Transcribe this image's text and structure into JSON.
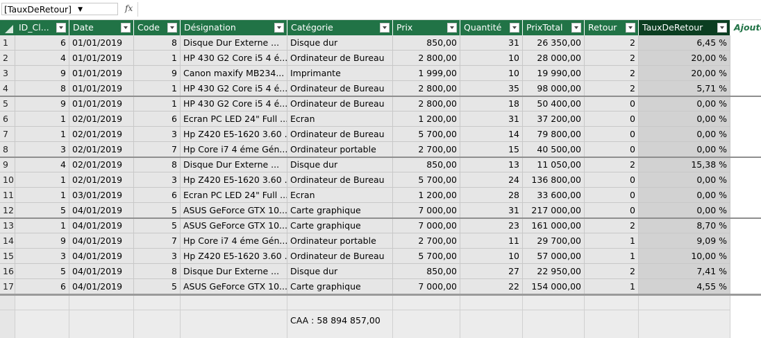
{
  "formula_bar": {
    "name_box": "[TauxDeRetour]",
    "fx_label": "fx",
    "formula": ""
  },
  "columns": [
    {
      "key": "id",
      "label": "ID_Cl..."
    },
    {
      "key": "date",
      "label": "Date"
    },
    {
      "key": "code",
      "label": "Code"
    },
    {
      "key": "designation",
      "label": "Désignation"
    },
    {
      "key": "categorie",
      "label": "Catégorie"
    },
    {
      "key": "prix",
      "label": "Prix"
    },
    {
      "key": "quantite",
      "label": "Quantité"
    },
    {
      "key": "prixtotal",
      "label": "PrixTotal"
    },
    {
      "key": "retour",
      "label": "Retour"
    },
    {
      "key": "taux",
      "label": "TauxDeRetour"
    }
  ],
  "add_column_label": "Ajoute",
  "rows": [
    [
      "1",
      "6",
      "01/01/2019",
      "8",
      "Disque Dur Externe ...",
      "Disque dur",
      "850,00",
      "31",
      "26 350,00",
      "2",
      "6,45 %"
    ],
    [
      "2",
      "4",
      "01/01/2019",
      "1",
      "HP 430 G2 Core i5 4 é...",
      "Ordinateur de Bureau",
      "2 800,00",
      "10",
      "28 000,00",
      "2",
      "20,00 %"
    ],
    [
      "3",
      "9",
      "01/01/2019",
      "9",
      "Canon maxify MB234...",
      "Imprimante",
      "1 999,00",
      "10",
      "19 990,00",
      "2",
      "20,00 %"
    ],
    [
      "4",
      "8",
      "01/01/2019",
      "1",
      "HP 430 G2 Core i5 4 é...",
      "Ordinateur de Bureau",
      "2 800,00",
      "35",
      "98 000,00",
      "2",
      "5,71 %"
    ],
    [
      "5",
      "9",
      "01/01/2019",
      "1",
      "HP 430 G2 Core i5 4 é...",
      "Ordinateur de Bureau",
      "2 800,00",
      "18",
      "50 400,00",
      "0",
      "0,00 %"
    ],
    [
      "6",
      "1",
      "02/01/2019",
      "6",
      "Ecran PC LED 24\" Full ...",
      "Ecran",
      "1 200,00",
      "31",
      "37 200,00",
      "0",
      "0,00 %"
    ],
    [
      "7",
      "1",
      "02/01/2019",
      "3",
      "Hp Z420 E5-1620 3.60 ...",
      "Ordinateur de Bureau",
      "5 700,00",
      "14",
      "79 800,00",
      "0",
      "0,00 %"
    ],
    [
      "8",
      "3",
      "02/01/2019",
      "7",
      "Hp Core i7 4 éme Gén...",
      "Ordinateur portable",
      "2 700,00",
      "15",
      "40 500,00",
      "0",
      "0,00 %"
    ],
    [
      "9",
      "4",
      "02/01/2019",
      "8",
      "Disque Dur Externe ...",
      "Disque dur",
      "850,00",
      "13",
      "11 050,00",
      "2",
      "15,38 %"
    ],
    [
      "10",
      "1",
      "02/01/2019",
      "3",
      "Hp Z420 E5-1620 3.60 ...",
      "Ordinateur de Bureau",
      "5 700,00",
      "24",
      "136 800,00",
      "0",
      "0,00 %"
    ],
    [
      "11",
      "1",
      "03/01/2019",
      "6",
      "Ecran PC LED 24\" Full ...",
      "Ecran",
      "1 200,00",
      "28",
      "33 600,00",
      "0",
      "0,00 %"
    ],
    [
      "12",
      "5",
      "04/01/2019",
      "5",
      "ASUS GeForce GTX 10...",
      "Carte graphique",
      "7 000,00",
      "31",
      "217 000,00",
      "0",
      "0,00 %"
    ],
    [
      "13",
      "1",
      "04/01/2019",
      "5",
      "ASUS GeForce GTX 10...",
      "Carte graphique",
      "7 000,00",
      "23",
      "161 000,00",
      "2",
      "8,70 %"
    ],
    [
      "14",
      "9",
      "04/01/2019",
      "7",
      "Hp Core i7 4 éme Gén...",
      "Ordinateur portable",
      "2 700,00",
      "11",
      "29 700,00",
      "1",
      "9,09 %"
    ],
    [
      "15",
      "3",
      "04/01/2019",
      "3",
      "Hp Z420 E5-1620 3.60 ...",
      "Ordinateur de Bureau",
      "5 700,00",
      "10",
      "57 000,00",
      "1",
      "10,00 %"
    ],
    [
      "16",
      "5",
      "04/01/2019",
      "8",
      "Disque Dur Externe ...",
      "Disque dur",
      "850,00",
      "27",
      "22 950,00",
      "2",
      "7,41 %"
    ],
    [
      "17",
      "6",
      "04/01/2019",
      "5",
      "ASUS GeForce GTX 10...",
      "Carte graphique",
      "7 000,00",
      "22",
      "154 000,00",
      "1",
      "4,55 %"
    ]
  ],
  "measure": "CAA : 58 894 857,00",
  "colors": {
    "header_bg": "#217346",
    "header_active_bg": "#0b3e21",
    "cell_bg": "#e6e6e6",
    "selected_column_bg": "#d2d2d2"
  }
}
